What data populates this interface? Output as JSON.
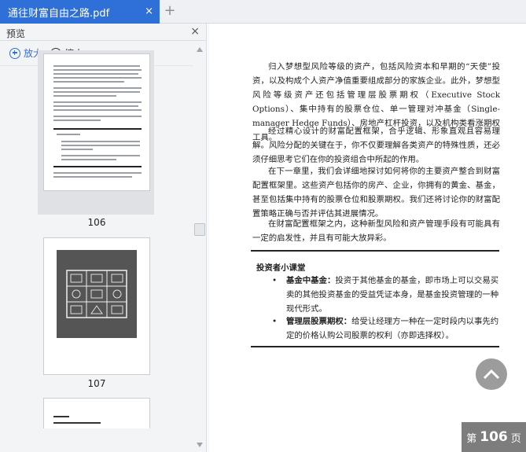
{
  "tab": {
    "title": "通往财富自由之路.pdf",
    "close": "×",
    "new": "+"
  },
  "sidebar": {
    "title": "预览",
    "close": "×",
    "zoom_in": "放大",
    "zoom_out": "缩小",
    "pages": [
      "106",
      "107"
    ]
  },
  "document": {
    "p1": "归入梦想型风险等级的资产，包括风险资本和早期的“天使”投资，以及构成个人资产净值重要组成部分的家族企业。此外，梦想型风险等级资产还包括管理层股票期权（Executive Stock Options）、集中持有的股票仓位、单一管理对冲基金（Single-manager Hedge Funds）、房地产杠杆投资，以及机构类看涨期权工具。",
    "p2": "经过精心设计的财富配置框架，合乎逻辑、形象直观且容易理解。风险分配的关键在于，你不仅要理解各类资产的特殊性质，还必须仔细思考它们在你的投资组合中所起的作用。",
    "p3": "在下一章里，我们会详细地探讨如何将你的主要资产整合到财富配置框架里。这些资产包括你的房产、企业，你拥有的黄金、基金，甚至包括集中持有的股票仓位和股票期权。我们还将讨论你的财富配置策略正确与否并评估其进展情况。",
    "p4": "在财富配置框架之内，这种新型风险和资产管理手段有可能具有一定的启发性，并且有可能大放异彩。",
    "box_title": "投资者小课堂",
    "bullets": [
      {
        "dot": "•",
        "term": "基金中基金：",
        "text": "投资于其他基金的基金，即市场上可以交易买卖的其他投资基金的受益凭证本身，是基金投资管理的一种现代形式。"
      },
      {
        "dot": "•",
        "term": "管理层股票期权：",
        "text": "给受让经理方一种在一定时段内以事先约定的价格认购公司股票的权利（亦即选择权）。"
      }
    ]
  },
  "page_indicator": {
    "prefix": "第",
    "number": "106",
    "suffix": "页"
  },
  "colors": {
    "accent": "#2f6fd8",
    "badge": "#7d7d7d"
  }
}
